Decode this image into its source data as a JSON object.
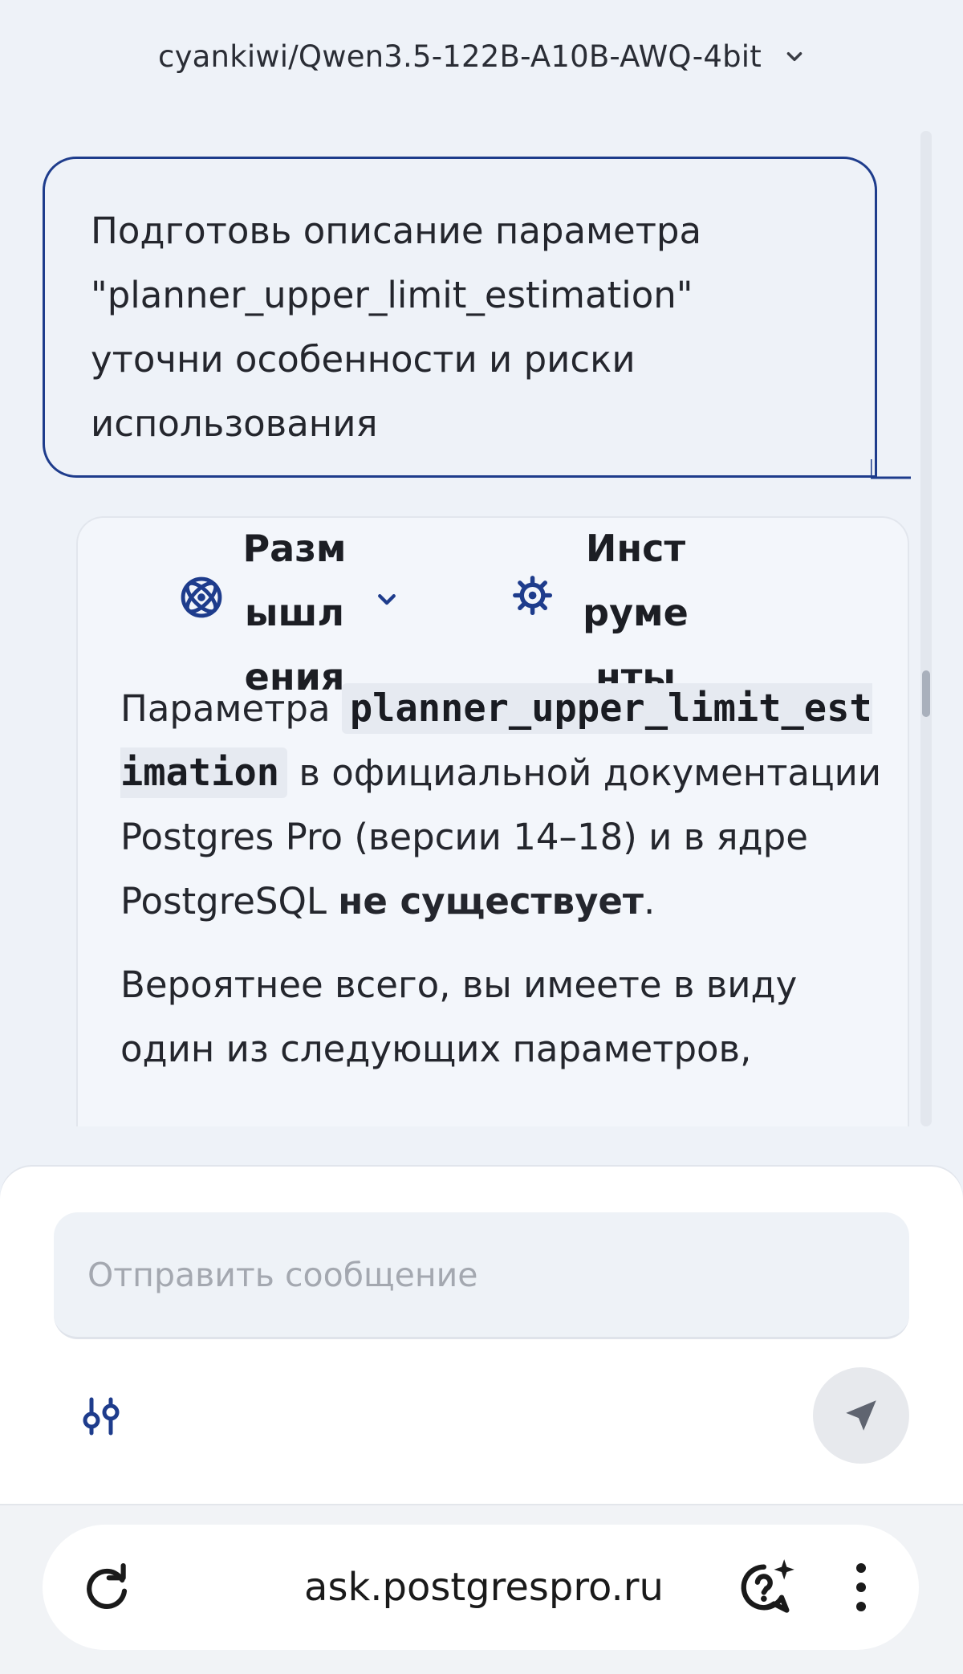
{
  "header": {
    "model_name": "cyankiwi/Qwen3.5-122B-A10B-AWQ-4bit",
    "chevron_icon": "chevron-down-icon"
  },
  "user_message": {
    "text": "Подготовь описание параметра \"planner_upper_limit_estimation\" уточни особенности и риски использования"
  },
  "assistant": {
    "thinking_label": "Размышления",
    "tools_label": "Инструменты",
    "para1_prefix": "Параметра ",
    "para1_code": "planner_upper_limit_estimation",
    "para1_middle": " в официальной документации Postgres Pro (версии 14–18) и в ядре PostgreSQL ",
    "para1_bold": "не существует",
    "para1_suffix": ".",
    "para2": "Вероятнее всего, вы имеете в виду один из следующих параметров,"
  },
  "composer": {
    "placeholder": "Отправить сообщение",
    "settings_icon": "sliders-icon",
    "send_icon": "send-icon"
  },
  "browser": {
    "url": "ask.postgrespro.ru",
    "reload_icon": "reload-icon",
    "help_icon": "help-sparkle-icon",
    "menu_icon": "more-vertical-icon"
  },
  "colors": {
    "accent": "#1e3c8c",
    "background": "#eef2f8",
    "card": "#f3f6fb"
  }
}
